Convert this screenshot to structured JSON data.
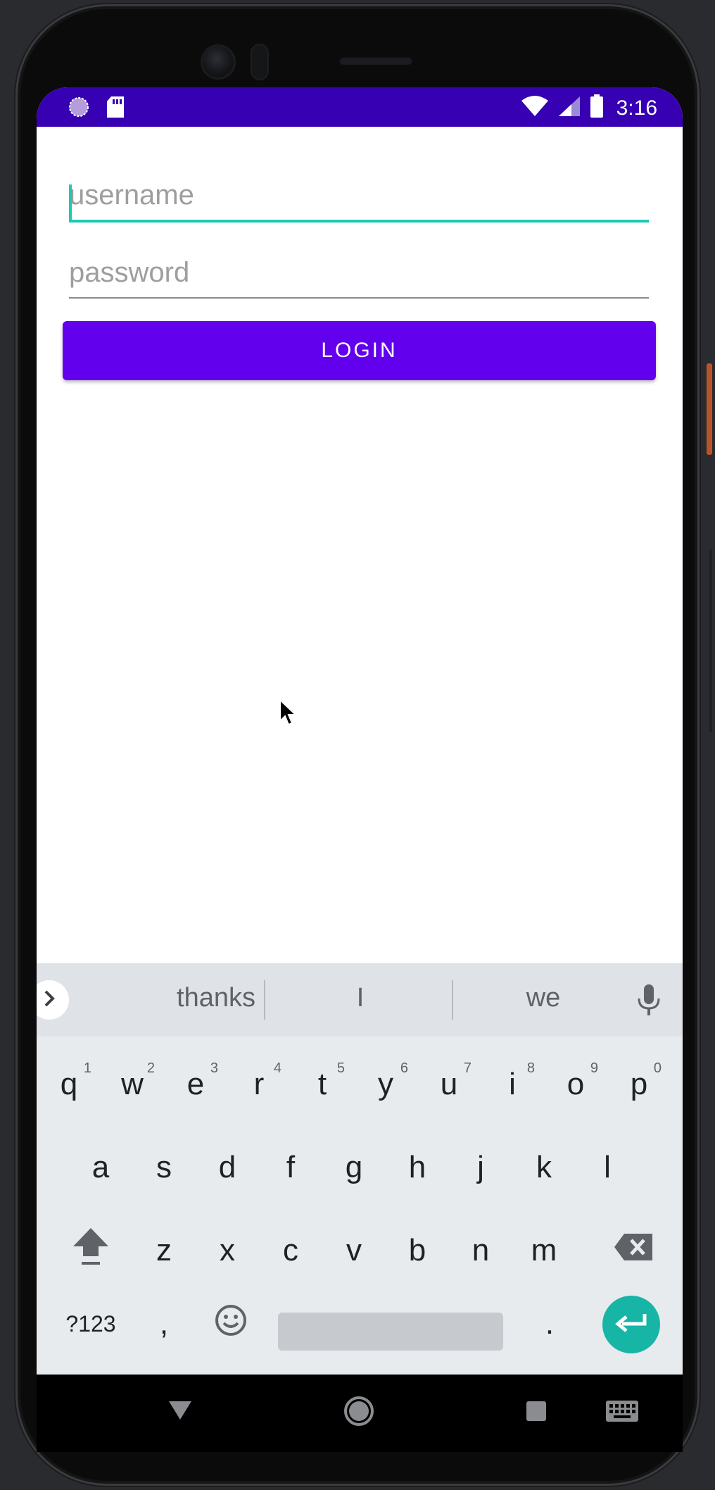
{
  "status_bar": {
    "time": "3:16",
    "icons": [
      "loading-circle-icon",
      "sd-card-icon",
      "wifi-icon",
      "signal-icon",
      "battery-icon"
    ]
  },
  "form": {
    "username_placeholder": "username",
    "password_placeholder": "password",
    "login_label": "LOGIN"
  },
  "keyboard": {
    "suggestions": [
      "thanks",
      "I",
      "we"
    ],
    "row1": [
      {
        "k": "q",
        "n": "1"
      },
      {
        "k": "w",
        "n": "2"
      },
      {
        "k": "e",
        "n": "3"
      },
      {
        "k": "r",
        "n": "4"
      },
      {
        "k": "t",
        "n": "5"
      },
      {
        "k": "y",
        "n": "6"
      },
      {
        "k": "u",
        "n": "7"
      },
      {
        "k": "i",
        "n": "8"
      },
      {
        "k": "o",
        "n": "9"
      },
      {
        "k": "p",
        "n": "0"
      }
    ],
    "row2": [
      "a",
      "s",
      "d",
      "f",
      "g",
      "h",
      "j",
      "k",
      "l"
    ],
    "row3": [
      "z",
      "x",
      "c",
      "v",
      "b",
      "n",
      "m"
    ],
    "symbols_label": "?123",
    "comma_label": ",",
    "period_label": "."
  },
  "colors": {
    "status_bar": "#3700b3",
    "primary": "#6200ee",
    "accent": "#1fc8b4",
    "enter_key": "#16b5a5"
  }
}
